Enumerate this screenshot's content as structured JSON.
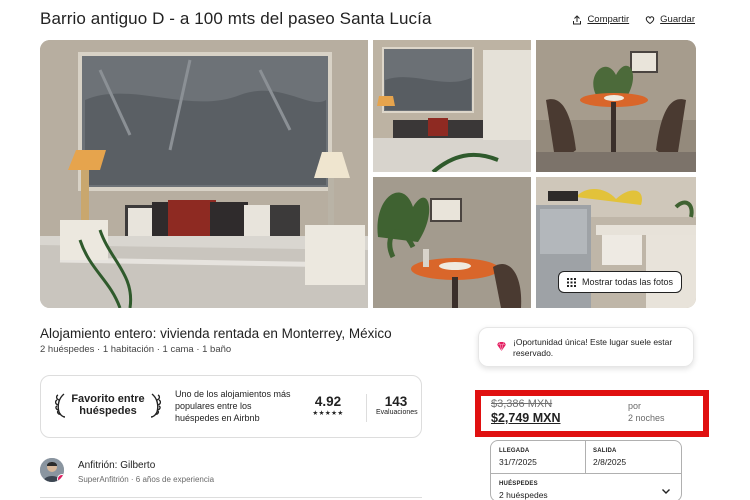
{
  "listing": {
    "title": "Barrio antiguo D - a 100 mts del paseo Santa Lucía",
    "share_label": "Compartir",
    "save_label": "Guardar",
    "show_all_photos": "Mostrar todas las fotos",
    "subtitle": "Alojamiento entero: vivienda rentada en Monterrey, México",
    "details": "2 huéspedes · 1 habitación · 1 cama · 1 baño"
  },
  "favorite": {
    "badge_text": "Favorito entre huéspedes",
    "description": "Uno de los alojamientos más populares entre los huéspedes en Airbnb",
    "rating": "4.92",
    "stars": "★★★★★",
    "reviews_count": "143",
    "reviews_label": "Evaluaciones"
  },
  "host": {
    "name": "Anfitrión: Gilberto",
    "subtitle": "SuperAnfitrión · 6 años de experiencia"
  },
  "opportunity": {
    "text": "¡Oportunidad única! Este lugar suele estar reservado."
  },
  "pricing": {
    "old_price": "$3,386 MXN",
    "new_price": "$2,749 MXN",
    "per_label": "por",
    "nights_label": "2 noches",
    "highlight_color": "#e01010"
  },
  "booking": {
    "checkin_label": "LLEGADA",
    "checkin_value": "31/7/2025",
    "checkout_label": "SALIDA",
    "checkout_value": "2/8/2025",
    "guests_label": "HUÉSPEDES",
    "guests_value": "2 huéspedes"
  },
  "icons": {
    "share": "share-icon",
    "save": "heart-icon",
    "grid": "grid-icon",
    "laurel": "laurel-icon",
    "gem": "gem-icon",
    "chevron": "chevron-down-icon"
  },
  "colors": {
    "accent": "#e31c5f",
    "text": "#222222",
    "muted": "#6a6a6a"
  }
}
